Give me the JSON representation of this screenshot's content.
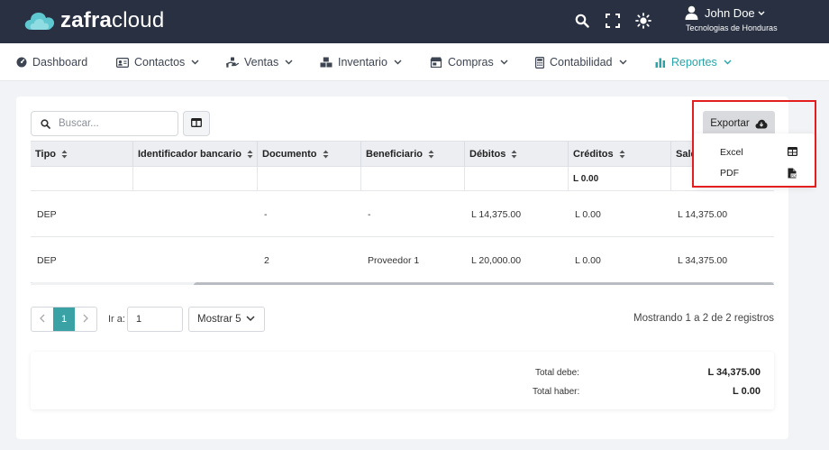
{
  "app": {
    "logo_bold": "zafra",
    "logo_light": "cloud"
  },
  "user": {
    "name": "John Doe",
    "company": "Tecnologias de Honduras"
  },
  "nav": {
    "items": [
      {
        "label": "Dashboard"
      },
      {
        "label": "Contactos"
      },
      {
        "label": "Ventas"
      },
      {
        "label": "Inventario"
      },
      {
        "label": "Compras"
      },
      {
        "label": "Contabilidad"
      },
      {
        "label": "Reportes"
      }
    ]
  },
  "toolbar": {
    "search_placeholder": "Buscar...",
    "export_label": "Exportar"
  },
  "export_menu": {
    "items": [
      {
        "label": "Excel"
      },
      {
        "label": "PDF"
      }
    ]
  },
  "table": {
    "columns": [
      "Tipo",
      "Identificador bancario",
      "Documento",
      "Beneficiario",
      "Débitos",
      "Créditos",
      "Saldo"
    ],
    "summary_credit": "L 0.00",
    "rows": [
      [
        "DEP",
        "",
        "-",
        "-",
        "L 14,375.00",
        "L 0.00",
        "L 14,375.00"
      ],
      [
        "DEP",
        "",
        "2",
        "Proveedor 1",
        "L 20,000.00",
        "L 0.00",
        "L 34,375.00"
      ]
    ]
  },
  "pagination": {
    "current_page": "1",
    "goto_label": "Ir a:",
    "goto_value": "1",
    "show_label": "Mostrar 5",
    "records_text": "Mostrando 1 a 2 de 2 registros"
  },
  "totals": {
    "debe_label": "Total debe:",
    "debe_value": "L 34,375.00",
    "haber_label": "Total haber:",
    "haber_value": "L 0.00"
  },
  "colors": {
    "topbar": "#283042",
    "accent": "#3aa1a4",
    "highlight": "#e41e1e"
  }
}
